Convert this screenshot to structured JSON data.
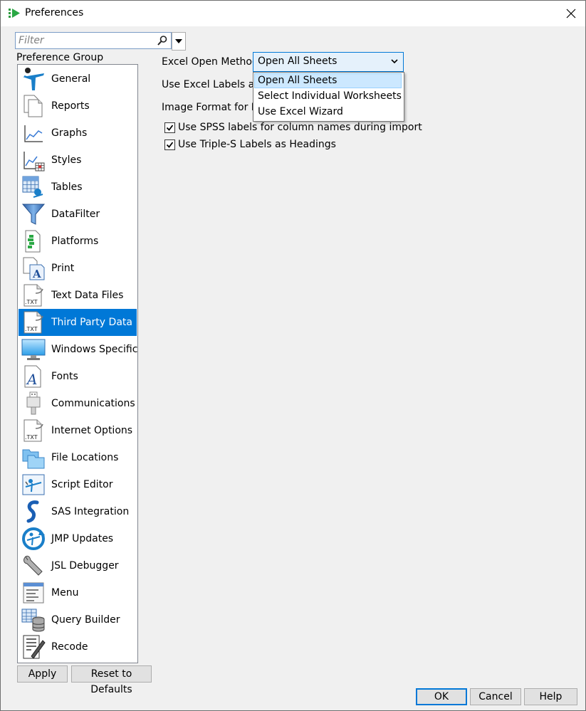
{
  "window": {
    "title": "Preferences"
  },
  "filter": {
    "placeholder": "Filter"
  },
  "group_label": "Preference Group",
  "groups": [
    {
      "label": "General",
      "icon": "jmp-man-icon"
    },
    {
      "label": "Reports",
      "icon": "documents-icon"
    },
    {
      "label": "Graphs",
      "icon": "line-graph-icon"
    },
    {
      "label": "Styles",
      "icon": "graph-table-icon"
    },
    {
      "label": "Tables",
      "icon": "data-table-icon"
    },
    {
      "label": "DataFilter",
      "icon": "funnel-icon"
    },
    {
      "label": "Platforms",
      "icon": "platforms-icon"
    },
    {
      "label": "Print",
      "icon": "print-icon"
    },
    {
      "label": "Text Data Files",
      "icon": "txt-file-icon"
    },
    {
      "label": "Third Party Data",
      "icon": "txt-file-icon"
    },
    {
      "label": "Windows Specific",
      "icon": "monitor-icon"
    },
    {
      "label": "Fonts",
      "icon": "font-icon"
    },
    {
      "label": "Communications",
      "icon": "usb-icon"
    },
    {
      "label": "Internet Options",
      "icon": "txt-file-icon"
    },
    {
      "label": "File Locations",
      "icon": "folders-icon"
    },
    {
      "label": "Script Editor",
      "icon": "script-icon"
    },
    {
      "label": "SAS Integration",
      "icon": "sas-icon"
    },
    {
      "label": "JMP Updates",
      "icon": "updates-icon"
    },
    {
      "label": "JSL Debugger",
      "icon": "wrench-icon"
    },
    {
      "label": "Menu",
      "icon": "menu-icon"
    },
    {
      "label": "Query Builder",
      "icon": "database-icon"
    },
    {
      "label": "Recode",
      "icon": "recode-icon"
    }
  ],
  "selected_group": "Third Party Data",
  "options": {
    "excel_open_method_label": "Excel Open Method",
    "excel_open_method_value": "Open All Sheets",
    "excel_open_method_options": [
      "Open All Sheets",
      "Select Individual Worksheets",
      "Use Excel Wizard"
    ],
    "excel_labels_label": "Use Excel Labels as Headings",
    "image_format_label": "Image Format for Pow",
    "spss_labels": {
      "label": "Use SPSS labels for column names during import",
      "checked": true
    },
    "triple_s_labels": {
      "label": "Use Triple-S Labels as Headings",
      "checked": true
    }
  },
  "buttons": {
    "apply": "Apply",
    "reset": "Reset to Defaults",
    "ok": "OK",
    "cancel": "Cancel",
    "help": "Help"
  },
  "colors": {
    "selection": "#0078d7",
    "dropdown_highlight": "#cce8ff"
  }
}
